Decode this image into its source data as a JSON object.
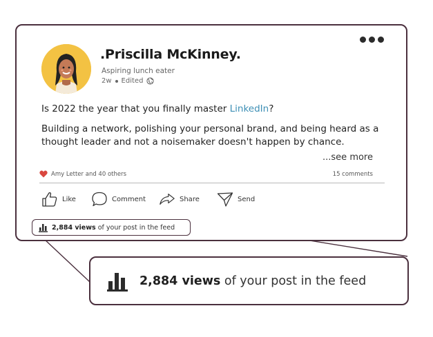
{
  "post": {
    "author_name": ".Priscilla McKinney.",
    "headline": "Aspiring lunch eater",
    "age": "2w",
    "edited": "Edited",
    "question_prefix": "Is 2022 the year that you finally master ",
    "question_link": "LinkedIn",
    "question_suffix": "?",
    "body_text": "Building a network, polishing your personal brand, and being heard as a thought leader and not a noisemaker doesn't happen by chance.",
    "see_more": "...see more"
  },
  "engagement": {
    "reactions_text": "Amy Letter and 40 others",
    "comments_text": "15 comments"
  },
  "actions": {
    "like": "Like",
    "comment": "Comment",
    "share": "Share",
    "send": "Send"
  },
  "views": {
    "count": "2,884 views",
    "suffix": " of your post in the feed"
  },
  "icons": {
    "more": "more-horizontal-icon",
    "globe": "globe-icon",
    "heart": "heart-icon",
    "like": "thumbs-up-icon",
    "comment": "speech-bubble-icon",
    "share": "share-arrow-icon",
    "send": "paper-plane-icon",
    "views": "bar-chart-icon"
  },
  "colors": {
    "frame": "#4a2f3d",
    "link": "#3d8fb5",
    "avatar_bg": "#f3c243",
    "heart": "#d9473f"
  }
}
